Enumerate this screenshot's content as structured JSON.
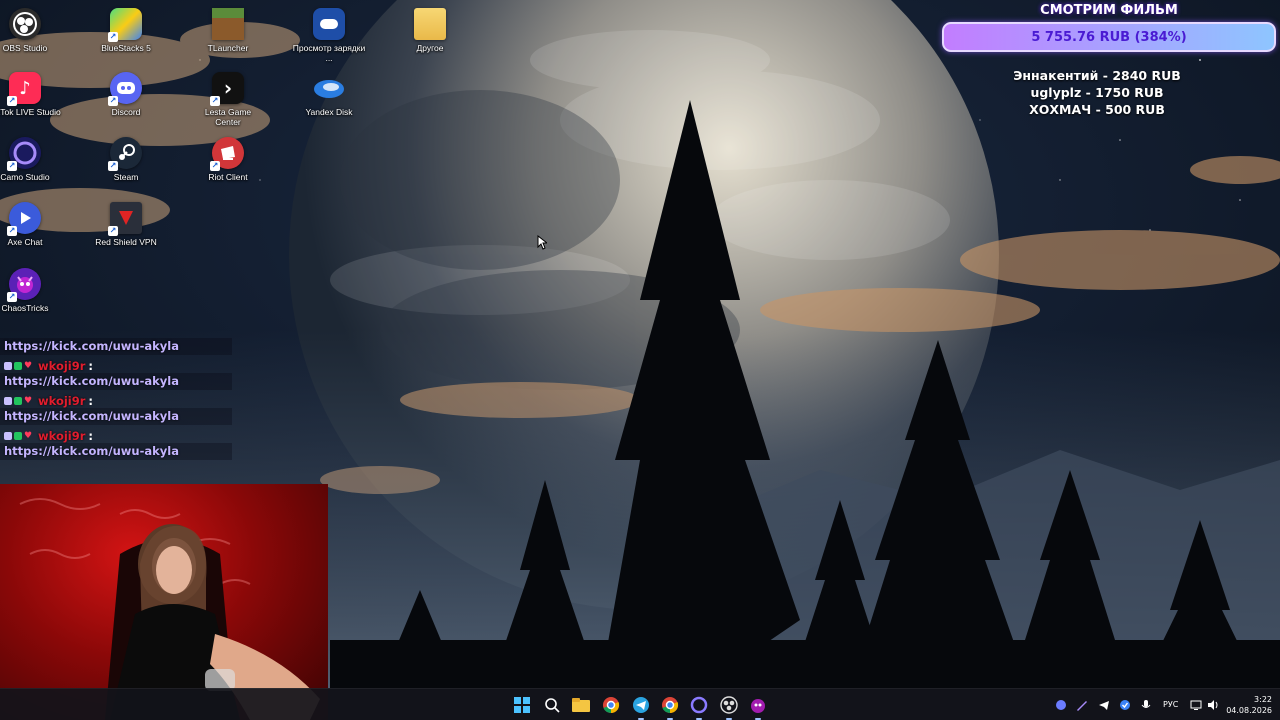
{
  "desktop": {
    "icons": [
      {
        "label": "OBS Studio",
        "icon": "obs-icon"
      },
      {
        "label": "BlueStacks 5",
        "icon": "bluestacks-icon"
      },
      {
        "label": "TLauncher",
        "icon": "tlauncher-icon"
      },
      {
        "label": "Просмотр зарядки ...",
        "icon": "gamepad-icon"
      },
      {
        "label": "Другое",
        "icon": "folder-icon"
      },
      {
        "label": "TikTok LIVE Studio",
        "icon": "tiktok-icon"
      },
      {
        "label": "Discord",
        "icon": "discord-icon"
      },
      {
        "label": "Lesta Game Center",
        "icon": "lesta-icon"
      },
      {
        "label": "Yandex Disk",
        "icon": "yandex-disk-icon"
      },
      {
        "label": "Camo Studio",
        "icon": "camo-icon"
      },
      {
        "label": "Steam",
        "icon": "steam-icon"
      },
      {
        "label": "Riot Client",
        "icon": "riot-icon"
      },
      {
        "label": "Axe Chat",
        "icon": "axe-chat-icon"
      },
      {
        "label": "Red Shield VPN",
        "icon": "vpn-shield-icon"
      },
      {
        "label": "ChaosTricks",
        "icon": "chaostricks-icon"
      }
    ]
  },
  "overlay": {
    "goal_title": "СМОТРИМ ФИЛЬМ",
    "goal_amount": "5 755.76 RUB (384%)",
    "goal_progress_percent": 384,
    "donors": [
      "Эннакентий - 2840 RUB",
      "uglyplz - 1750 RUB",
      "ХОХМАЧ - 500 RUB"
    ]
  },
  "chat": {
    "messages": [
      {
        "user": "",
        "text": "https://kick.com/uwu-akyla"
      },
      {
        "user": "wkoji9r",
        "text": "https://kick.com/uwu-akyla"
      },
      {
        "user": "wkoji9r",
        "text": "https://kick.com/uwu-akyla"
      },
      {
        "user": "wkoji9r",
        "text": "https://kick.com/uwu-akyla"
      }
    ]
  },
  "taskbar": {
    "apps": [
      "windows-start-icon",
      "search-icon",
      "file-explorer-icon",
      "chrome-icon",
      "telegram-icon",
      "chrome-icon",
      "camo-icon",
      "obs-icon",
      "chaostricks-icon"
    ],
    "language": "РУС",
    "time": "3:22",
    "date": "04.08.2026"
  },
  "colors": {
    "accent": "#7c3aed",
    "goal_text": "#4a1bd3",
    "chat_user": "#e11d2e",
    "chat_link": "#c4b5ff"
  }
}
